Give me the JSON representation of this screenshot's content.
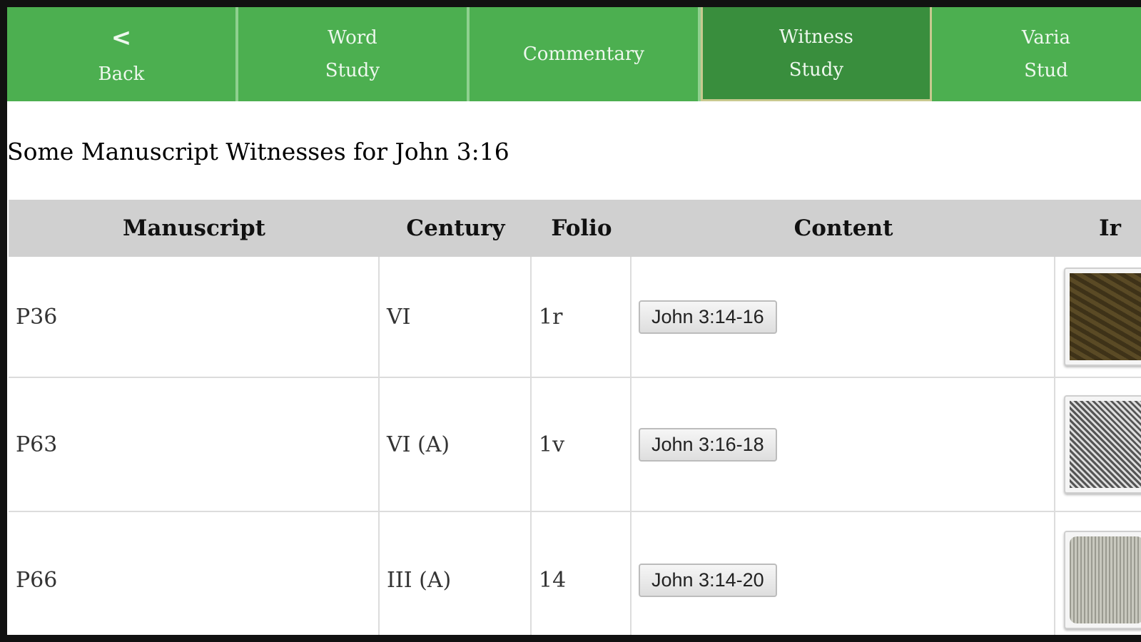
{
  "nav": {
    "back": {
      "icon": "chevron-left",
      "glyph": "<",
      "label": "Back"
    },
    "tabs": [
      {
        "line1": "Word",
        "line2": "Study"
      },
      {
        "line1": "Commentary",
        "line2": ""
      },
      {
        "line1": "Witness",
        "line2": "Study",
        "active": true
      },
      {
        "line1": "Varia",
        "line2": "Stud"
      }
    ]
  },
  "page": {
    "title": "Some Manuscript Witnesses for John 3:16"
  },
  "table": {
    "headers": [
      "Manuscript",
      "Century",
      "Folio",
      "Content",
      "Ir"
    ],
    "rows": [
      {
        "manuscript": "P36",
        "century": "VI",
        "folio": "1r",
        "content": "John 3:14-16",
        "image": "manuscript-thumbnail"
      },
      {
        "manuscript": "P63",
        "century": "VI (A)",
        "folio": "1v",
        "content": "John 3:16-18",
        "image": "manuscript-thumbnail"
      },
      {
        "manuscript": "P66",
        "century": "III (A)",
        "folio": "14",
        "content": "John 3:14-20",
        "image": "manuscript-thumbnail"
      }
    ]
  },
  "colors": {
    "tab": "#4caf50",
    "tab_active": "#398e3d",
    "header_bg": "#d0d0d0"
  }
}
